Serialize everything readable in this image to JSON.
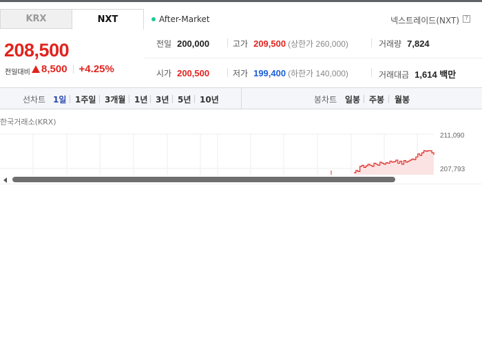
{
  "tabs": [
    {
      "label": "KRX",
      "active": false
    },
    {
      "label": "NXT",
      "active": true
    }
  ],
  "session": "After-Market",
  "market_title": "넥스트레이드(NXT)",
  "help_glyph": "?",
  "quote": {
    "price": "208,500",
    "change_label": "전일대비",
    "change_value": "8,500",
    "change_percent": "+4.25%"
  },
  "stats": {
    "prev_close": {
      "label": "전일",
      "value": "200,000"
    },
    "high": {
      "label": "고가",
      "value": "209,500",
      "limit": "(상한가 260,000)"
    },
    "volume": {
      "label": "거래량",
      "value": "7,824"
    },
    "open": {
      "label": "시가",
      "value": "200,500"
    },
    "low": {
      "label": "저가",
      "value": "199,400",
      "limit": "(하한가 140,000)"
    },
    "amount": {
      "label": "거래대금",
      "value": "1,614 백만"
    }
  },
  "toolbar": {
    "line_chart_label": "선차트",
    "periods": [
      "1일",
      "1주일",
      "3개월",
      "1년",
      "3년",
      "5년",
      "10년"
    ],
    "active_period": "1일",
    "candle_chart_label": "봉차트",
    "candle_periods": [
      "일봉",
      "주봉",
      "월봉"
    ]
  },
  "chart_label": "한국거래소(KRX)",
  "chart_data": {
    "type": "line",
    "yticks": [
      "211,090",
      "207,793"
    ],
    "ylim": [
      200000,
      211500
    ],
    "series_color": "#e0241e",
    "x": [
      0,
      1,
      2,
      3,
      4,
      5,
      6,
      7,
      8,
      9,
      10,
      11,
      12,
      13,
      14,
      15,
      16,
      17,
      18,
      19,
      20,
      21,
      22,
      23,
      24,
      25,
      26,
      27,
      28,
      29,
      30,
      31,
      32,
      33,
      34,
      35,
      36,
      37,
      38,
      39,
      40
    ],
    "values": [
      207400,
      207600,
      207500,
      208000,
      208100,
      207900,
      208050,
      208200,
      208100,
      208000,
      208300,
      208200,
      208100,
      208400,
      208300,
      208200,
      208350,
      208300,
      208500,
      208400,
      208450,
      208600,
      208300,
      208500,
      208200,
      208550,
      208400,
      208500,
      208600,
      208700,
      208650,
      208900,
      209200,
      209050,
      209300,
      209500,
      209450,
      209500,
      209500,
      209300,
      209100
    ]
  },
  "colors": {
    "up": "#e0241e",
    "down": "#1a5ed8",
    "active": "#2a48b0"
  }
}
